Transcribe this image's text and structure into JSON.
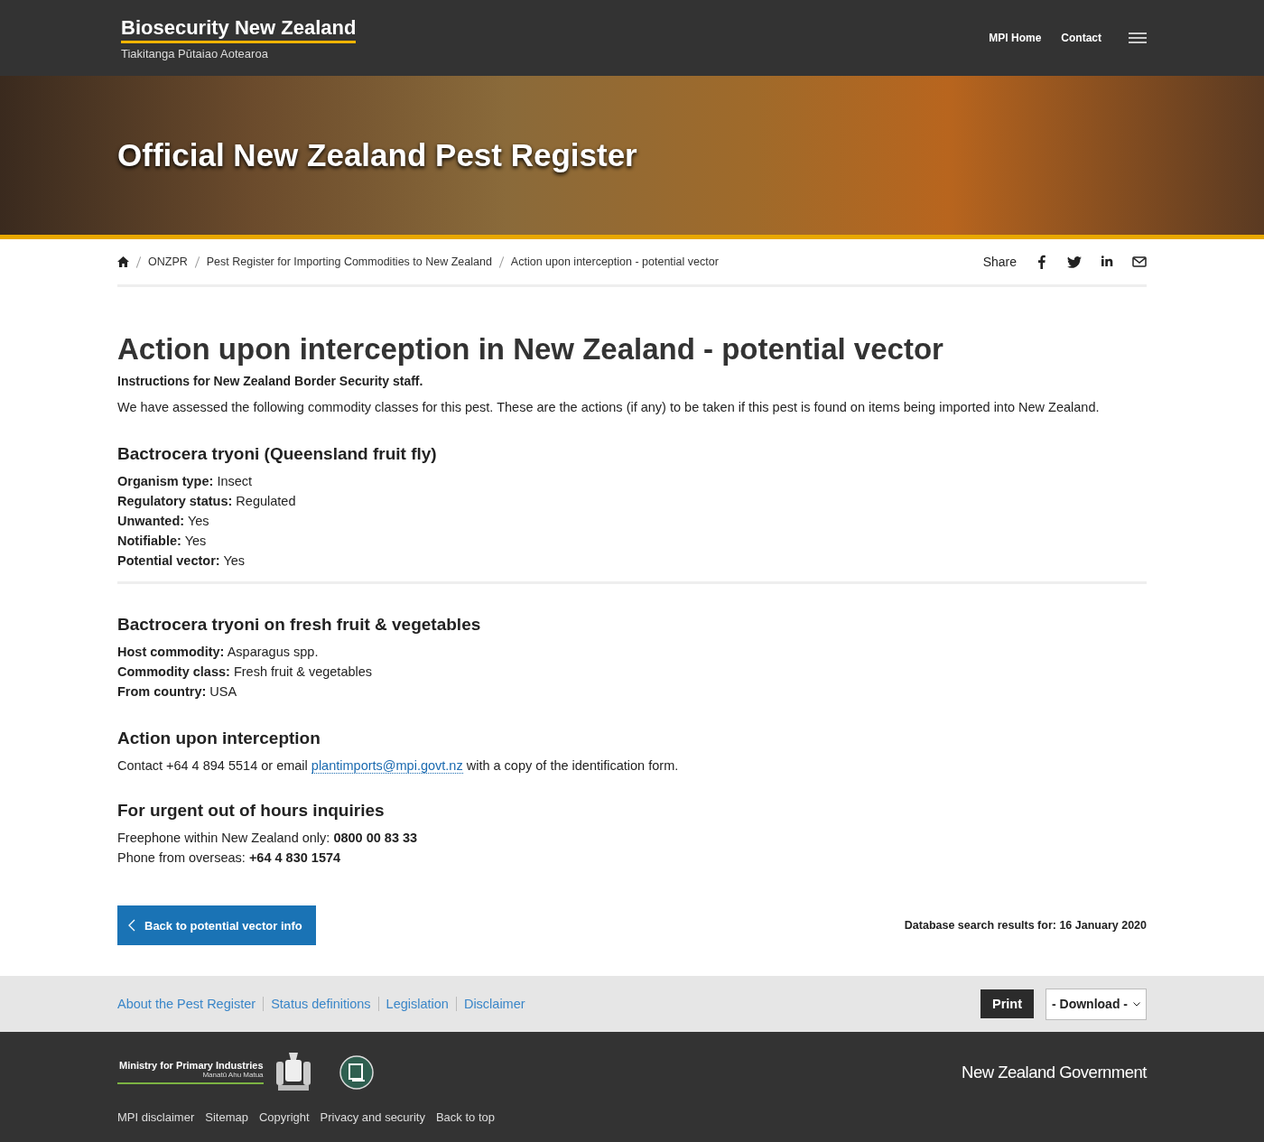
{
  "header": {
    "logo_title": "Biosecurity New Zealand",
    "logo_subtitle": "Tiakitanga Pūtaiao Aotearoa",
    "nav": [
      "MPI Home",
      "Contact"
    ]
  },
  "hero": {
    "title": "Official New Zealand Pest Register"
  },
  "breadcrumb": [
    "ONZPR",
    "Pest Register for Importing Commodities to New Zealand",
    "Action upon interception - potential vector"
  ],
  "share": {
    "label": "Share",
    "networks": [
      {
        "kind": "facebook"
      },
      {
        "kind": "twitter"
      },
      {
        "kind": "linkedin"
      },
      {
        "kind": "email"
      }
    ]
  },
  "page": {
    "title": "Action upon interception in New Zealand - potential vector",
    "subtitle": "Instructions for New Zealand Border Security staff.",
    "intro": "We have assessed the following commodity classes for this pest. These are the actions (if any) to be taken if this pest is found on items being imported into New Zealand."
  },
  "pest": {
    "heading": "Bactrocera tryoni (Queensland fruit fly)",
    "facts": [
      "**Organism type:** Insect",
      "**Regulatory status:** Regulated",
      "**Unwanted:** Yes",
      "**Notifiable:** Yes",
      "**Potential vector:** Yes"
    ]
  },
  "commodity": {
    "heading": "Bactrocera tryoni on fresh fruit & vegetables",
    "facts": [
      "**Host commodity:** Asparagus spp.",
      "**Commodity class:** Fresh fruit & vegetables",
      "**From country:** USA"
    ]
  },
  "action": {
    "heading": "Action upon interception",
    "before": "Contact +64 4 894 5514 or email",
    "link": "plantimports@mpi.govt.nz",
    "after": "with a copy of the identification form."
  },
  "urgent": {
    "heading": "For urgent out of hours inquiries",
    "lines": [
      "Freephone within New Zealand only: **0800 00 83 33**",
      "Phone from overseas: **+64 4 830 1574**"
    ]
  },
  "back_button": "Back to potential vector info",
  "search_date": "Database search results for: 16 January 2020",
  "footer_links": [
    "About the Pest Register",
    "Status definitions",
    "Legislation",
    "Disclaimer"
  ],
  "print_button": "Print",
  "download_select": "- Download -",
  "bottom": {
    "mpi_title": "Ministry for Primary Industries",
    "mpi_subtitle": "Manatū Ahu Matua",
    "govt": "New Zealand Government",
    "links": [
      "MPI disclaimer",
      "Sitemap",
      "Copyright",
      "Privacy and security",
      "Back to top"
    ]
  }
}
